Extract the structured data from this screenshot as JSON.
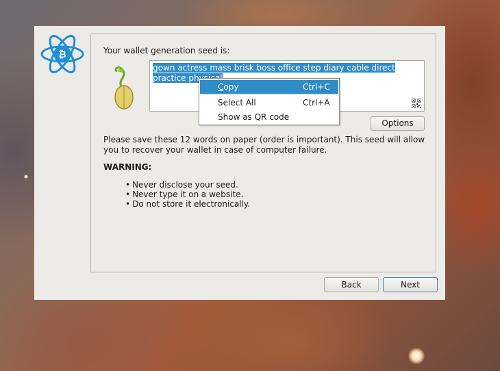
{
  "wizard": {
    "seed_label": "Your wallet generation seed is:",
    "seed_text_line1": "gown actress mass brisk boss office step diary cable direct",
    "seed_text_line2": "practice physical",
    "options_label": "Options",
    "info_text": "Please save these 12 words on paper (order is important). This seed will allow you to recover your wallet in case of computer failure.",
    "warning_title": "WARNING:",
    "warnings": [
      "Never disclose your seed.",
      "Never type it on a website.",
      "Do not store it electronically."
    ],
    "back_label": "Back",
    "next_label": "Next"
  },
  "context_menu": {
    "items": [
      {
        "label_first": "C",
        "label_rest": "opy",
        "shortcut": "Ctrl+C",
        "active": true
      },
      {
        "label": "Select All",
        "shortcut": "Ctrl+A"
      },
      {
        "label": "Show as QR code",
        "shortcut": ""
      }
    ]
  },
  "icons": {
    "logo": "electrum-bitcoin-logo-icon",
    "seed": "seed-sprout-icon",
    "qr": "qr-code-icon"
  },
  "colors": {
    "selection": "#308cc6",
    "logo_blue": "#1f8fd6",
    "dialog_bg": "#edebe7"
  }
}
